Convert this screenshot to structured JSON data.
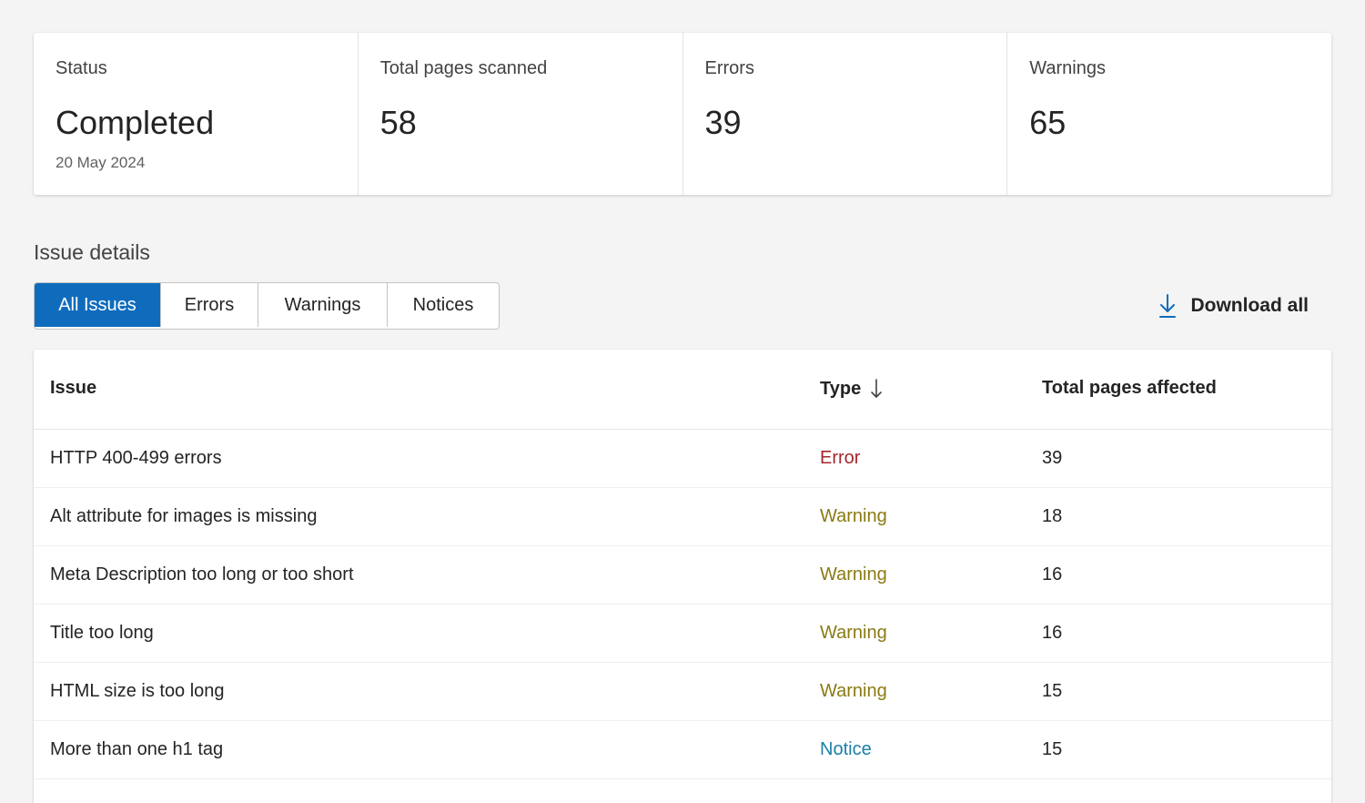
{
  "summary": {
    "status": {
      "label": "Status",
      "value": "Completed",
      "date": "20 May 2024"
    },
    "pages": {
      "label": "Total pages scanned",
      "value": "58"
    },
    "errors": {
      "label": "Errors",
      "value": "39"
    },
    "warnings": {
      "label": "Warnings",
      "value": "65"
    }
  },
  "issue_details": {
    "title": "Issue details",
    "tabs": [
      {
        "label": "All Issues",
        "active": true
      },
      {
        "label": "Errors",
        "active": false
      },
      {
        "label": "Warnings",
        "active": false
      },
      {
        "label": "Notices",
        "active": false
      }
    ],
    "download_label": "Download all"
  },
  "table": {
    "headers": {
      "issue": "Issue",
      "type": "Type",
      "total": "Total pages affected"
    },
    "rows": [
      {
        "issue": "HTTP 400-499 errors",
        "type": "Error",
        "total": "39"
      },
      {
        "issue": "Alt attribute for images is missing",
        "type": "Warning",
        "total": "18"
      },
      {
        "issue": "Meta Description too long or too short",
        "type": "Warning",
        "total": "16"
      },
      {
        "issue": "Title too long",
        "type": "Warning",
        "total": "16"
      },
      {
        "issue": "HTML size is too long",
        "type": "Warning",
        "total": "15"
      },
      {
        "issue": "More than one h1 tag",
        "type": "Notice",
        "total": "15"
      }
    ]
  },
  "colors": {
    "accent": "#0f6cbd",
    "error": "#a4262c",
    "warning": "#8a7a12",
    "notice": "#1a7fa8"
  },
  "icons": {
    "download": "arrow-down-to-line-icon",
    "sort": "arrow-down-icon"
  }
}
